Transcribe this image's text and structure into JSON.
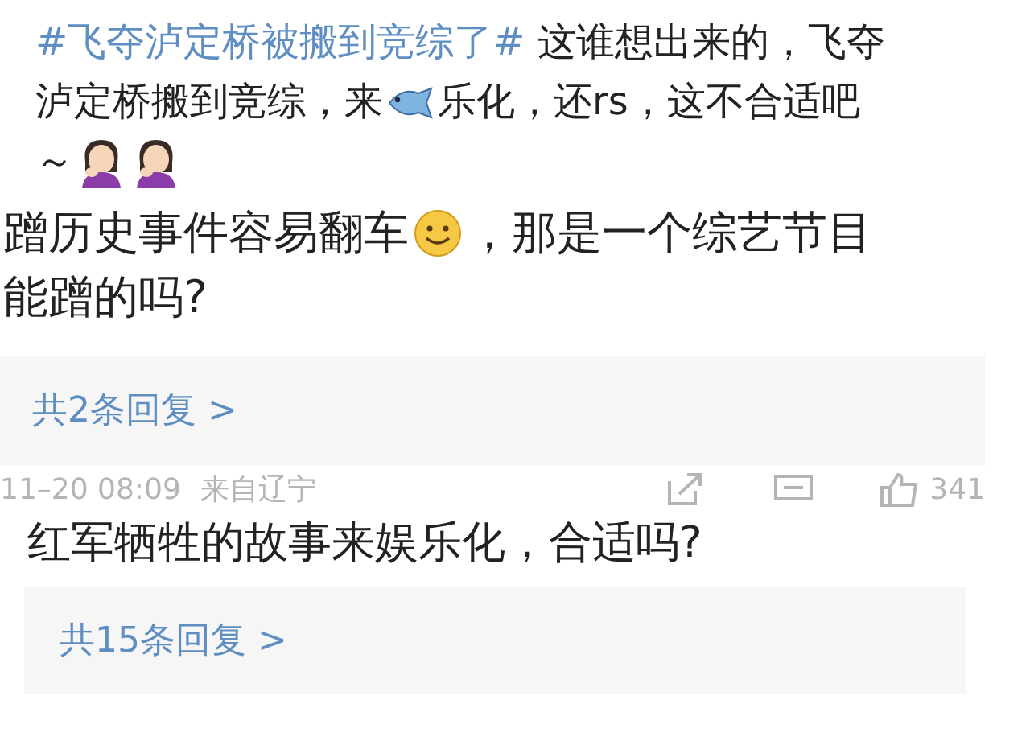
{
  "post": {
    "lines": [
      [
        {
          "kind": "hashtag",
          "text": "#飞夺泸定桥被搬到竞综了#"
        },
        {
          "kind": "text",
          "text": " 这谁想出来的，飞夺"
        }
      ],
      [
        {
          "kind": "text",
          "text": "泸定桥搬到竞综，来"
        },
        {
          "kind": "fish"
        },
        {
          "kind": "text",
          "text": "乐化，还rs，这不合适吧"
        }
      ],
      [
        {
          "kind": "text",
          "text": "～"
        },
        {
          "kind": "facepalm"
        },
        {
          "kind": "facepalm"
        }
      ]
    ]
  },
  "comments": [
    {
      "lines": [
        [
          {
            "kind": "text",
            "text": "蹭历史事件容易翻车"
          },
          {
            "kind": "smile"
          },
          {
            "kind": "text",
            "text": "，那是一个综艺节目"
          }
        ],
        [
          {
            "kind": "text",
            "text": "能蹭的吗?"
          }
        ]
      ],
      "replies": "共2条回复 >"
    },
    {
      "meta": {
        "time": "11–20 08:09",
        "location": "来自辽宁",
        "likes": "341"
      },
      "lines": [
        [
          {
            "kind": "text",
            "text": "红军牺牲的故事来娱乐化，合适吗?"
          }
        ]
      ],
      "replies": "共15条回复 >"
    }
  ]
}
